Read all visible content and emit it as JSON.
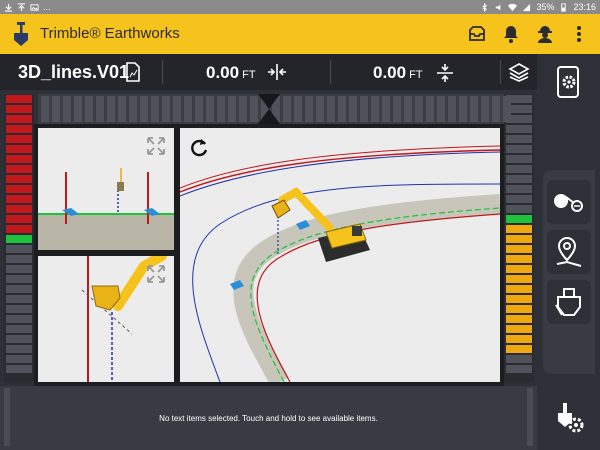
{
  "status_bar": {
    "left_overflow": "...",
    "battery": "35%",
    "time": "23:16"
  },
  "app_bar": {
    "title": "Trimble® Earthworks",
    "actions": [
      "inbox-icon",
      "bell-icon",
      "operator-icon",
      "more-vert-icon"
    ]
  },
  "info_bar": {
    "design_name": "3D_lines.V01",
    "cross_slope_value": "0.00",
    "cross_slope_unit": "FT",
    "vertical_value": "0.00",
    "vertical_unit": "FT"
  },
  "lightbars": {
    "left_on_grade_level": 0.46,
    "right_fill_level": 0.52
  },
  "colors": {
    "accent": "#f6c31d",
    "red": "#c0181c",
    "green": "#1ec23c",
    "amber": "#f0a812"
  },
  "right_panel": {
    "buttons": [
      "settings-screen-icon",
      "tool-icon",
      "location-icon",
      "implement-icon",
      "machine-settings-icon"
    ]
  },
  "views": {
    "plan_view_refresh_icon": "refresh-icon",
    "expand_icon": "expand-icon"
  },
  "message": "No text items selected. Touch and hold to see available items."
}
